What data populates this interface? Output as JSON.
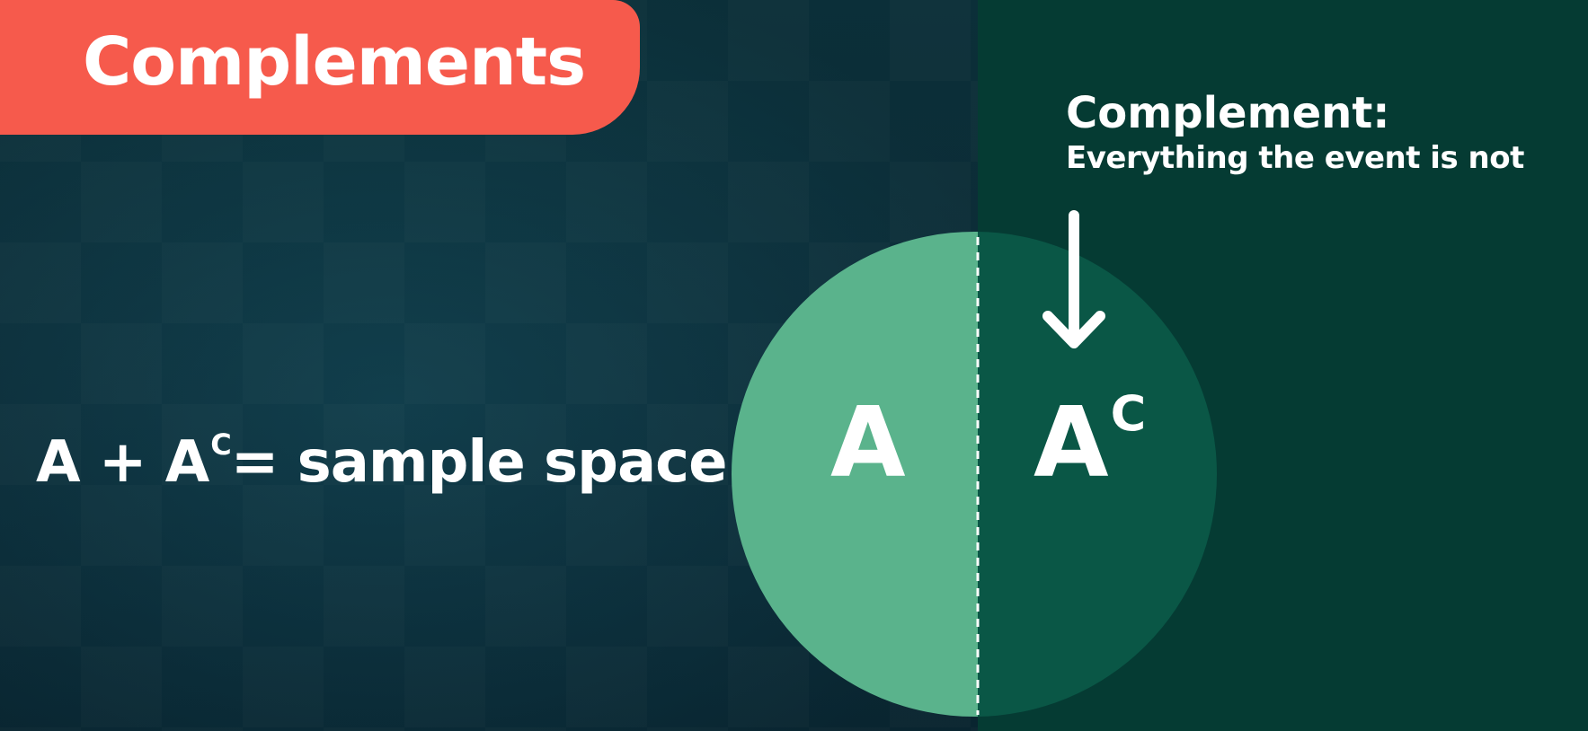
{
  "title": "Complements",
  "callout": {
    "heading": "Complement:",
    "description": "Everything the event is not"
  },
  "venn": {
    "left_label": "A",
    "right_label": "A",
    "right_superscript": "C",
    "left_color": "#5ab38c",
    "right_color": "#0a5746"
  },
  "equation": {
    "left": "A + A",
    "superscript": "C",
    "right": "= sample space"
  },
  "colors": {
    "banner": "#f65a4c",
    "background": "#0f3f4c",
    "right_panel": "#053b33",
    "text": "#ffffff"
  }
}
